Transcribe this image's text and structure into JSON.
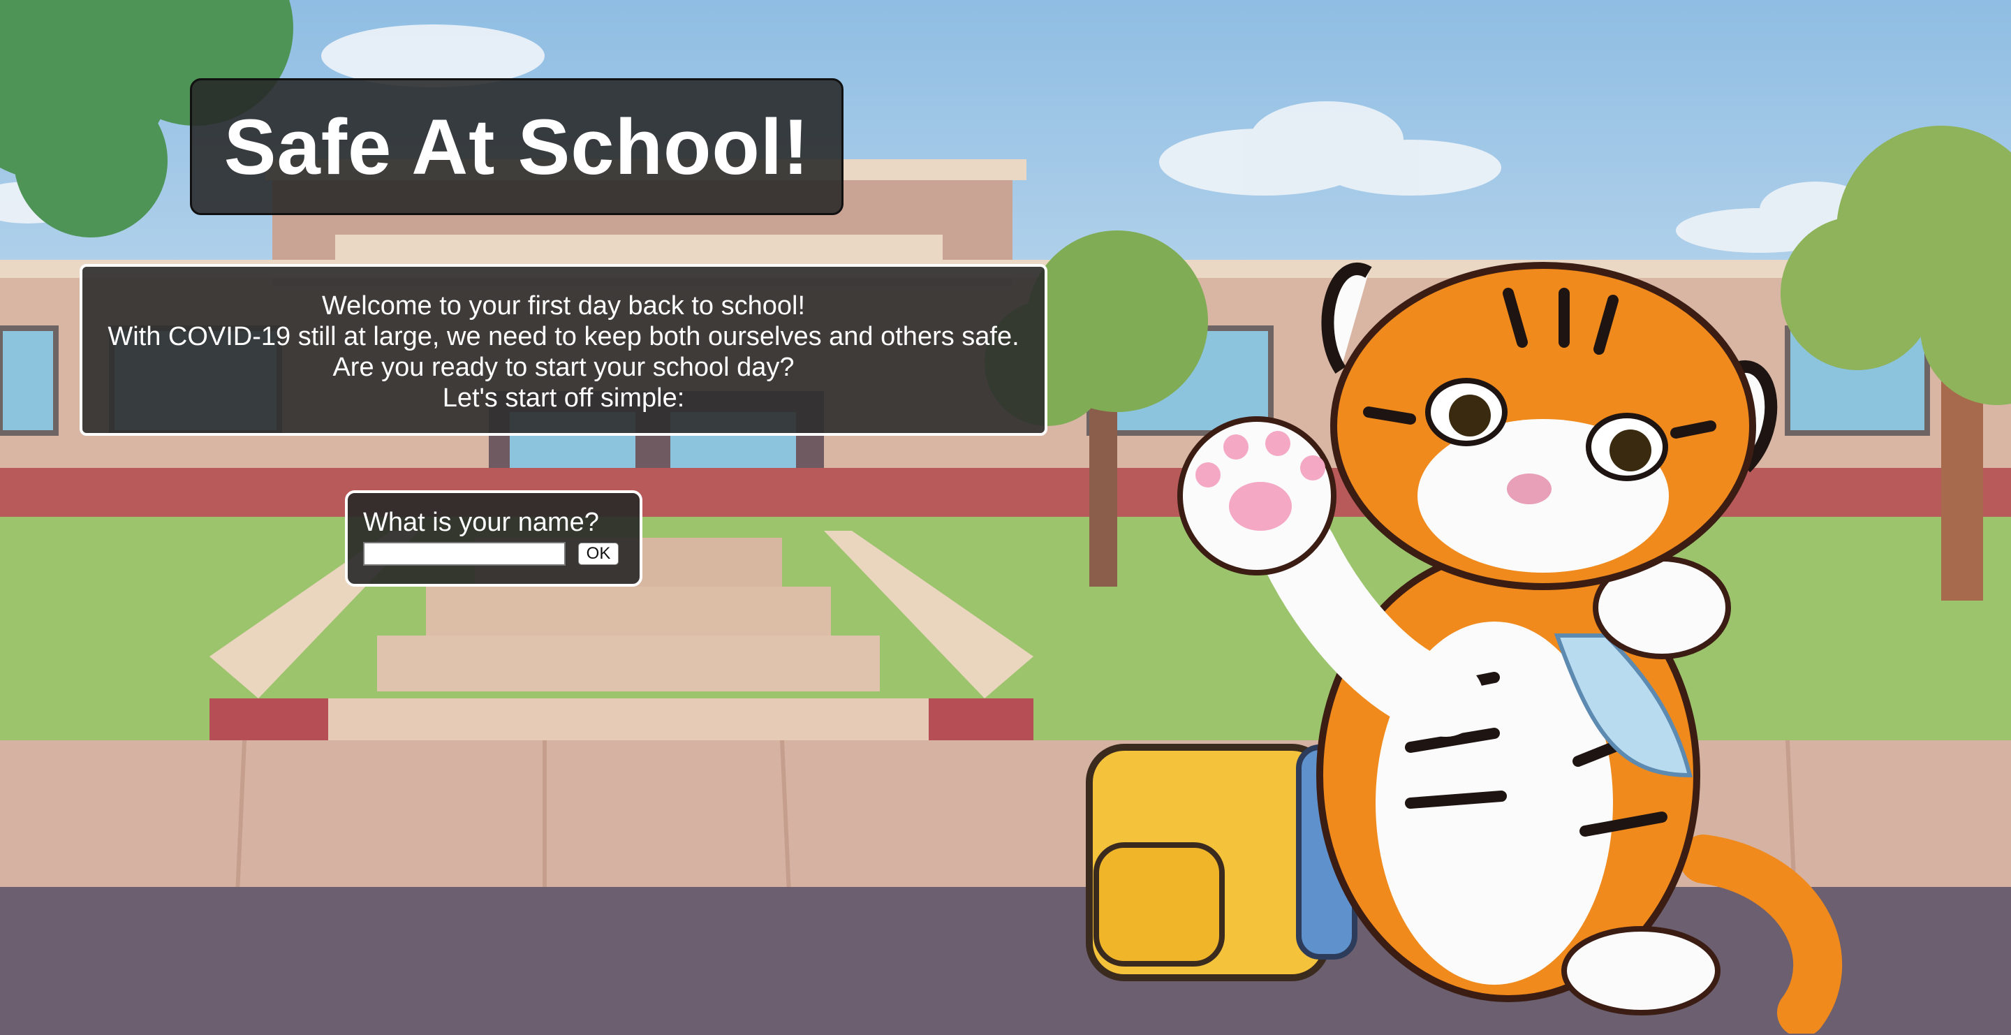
{
  "header": {
    "title": "Safe At School!"
  },
  "welcome": {
    "lines": [
      "Welcome to your first day back to school!",
      "With COVID-19 still at large, we need to keep both ourselves and others safe.",
      "Are you ready to start your school day?",
      "Let's start off simple:"
    ]
  },
  "name_prompt": {
    "label": "What is your name?",
    "input_value": "",
    "ok_label": "OK"
  },
  "mascot": {
    "icon": "tiger-cub-mascot-icon"
  },
  "colors": {
    "sky": "#a9cbe6",
    "panel": "#2d2d2d",
    "grass": "#9bc46a",
    "tiger_orange": "#f08a1c",
    "backpack_yellow": "#f5c23b"
  }
}
